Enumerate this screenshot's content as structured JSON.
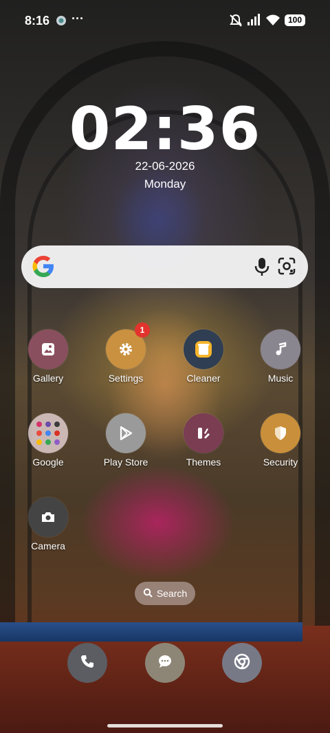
{
  "status_bar": {
    "time": "8:16",
    "more": "···",
    "battery": "100",
    "icons": [
      "app-notification-icon",
      "silent-icon",
      "signal-icon",
      "wifi-icon",
      "battery-icon"
    ]
  },
  "clock": {
    "time": "02:36",
    "date": "22-06-2026",
    "day": "Monday"
  },
  "search_bar": {
    "icons": [
      "google-logo",
      "mic-icon",
      "lens-icon"
    ]
  },
  "apps": [
    {
      "label": "Gallery",
      "icon": "gallery-icon",
      "color": "#8a4f5e"
    },
    {
      "label": "Settings",
      "icon": "gear-icon",
      "color": "#c99140",
      "badge": "1"
    },
    {
      "label": "Cleaner",
      "icon": "trash-icon",
      "color": "#2f3e52"
    },
    {
      "label": "Music",
      "icon": "music-note-icon",
      "color": "#8a8690"
    },
    {
      "label": "Google",
      "icon": "folder-icon",
      "color": "#d9c7c7"
    },
    {
      "label": "Play Store",
      "icon": "play-store-icon",
      "color": "#9a9a9a"
    },
    {
      "label": "Themes",
      "icon": "themes-icon",
      "color": "#7a3d52"
    },
    {
      "label": "Security",
      "icon": "shield-icon",
      "color": "#c98f3a"
    },
    {
      "label": "Camera",
      "icon": "camera-icon",
      "color": "#444"
    }
  ],
  "search_pill": {
    "label": "Search"
  },
  "dock": [
    {
      "icon": "phone-icon",
      "color": "#5b5d63"
    },
    {
      "icon": "message-icon",
      "color": "#8d8677"
    },
    {
      "icon": "chrome-icon",
      "color": "#777a86"
    }
  ]
}
